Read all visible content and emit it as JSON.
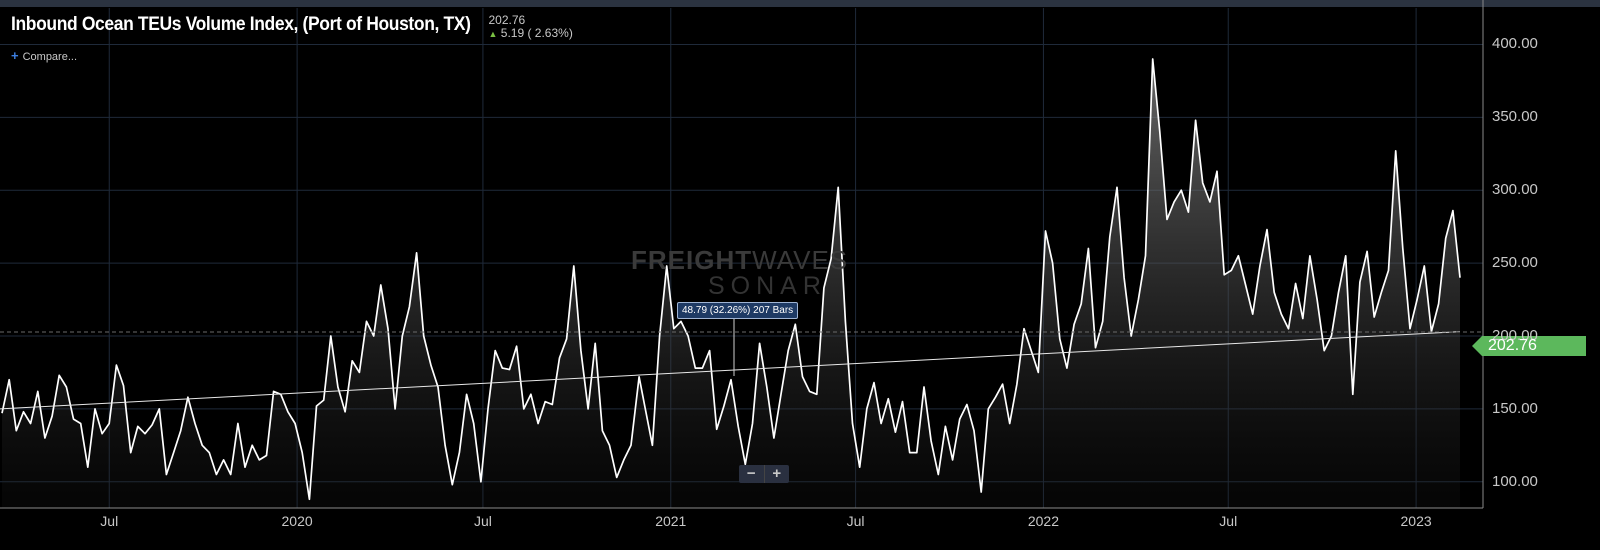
{
  "title": "Inbound Ocean TEUs Volume Index, (Port of Houston, TX)",
  "quote": {
    "last": "202.76",
    "change": "5.19",
    "change_pct": "( 2.63%)"
  },
  "compare_label": "Compare...",
  "watermark": {
    "brand_bold": "FREIGHT",
    "brand_light": "WAVES",
    "product": "SONAR"
  },
  "last_value_badge": "202.76",
  "measure_label": "48.79 (32.26%) 207 Bars",
  "zoom": {
    "minus": "−",
    "plus": "+"
  },
  "colors": {
    "background": "#000000",
    "line": "#ffffff",
    "grid": "#1f2a3a",
    "badge": "#5cb85c",
    "up_arrow": "#7ac143"
  },
  "chart_data": {
    "type": "area",
    "title": "Inbound Ocean TEUs Volume Index, (Port of Houston, TX)",
    "x_tick_labels": [
      "Jul",
      "2020",
      "Jul",
      "2021",
      "Jul",
      "2022",
      "Jul",
      "2023"
    ],
    "y_tick_labels": [
      "100.00",
      "150.00",
      "200.00",
      "250.00",
      "300.00",
      "350.00",
      "400.00"
    ],
    "ylim": [
      82,
      425
    ],
    "grid": true,
    "x_range": [
      "2019-03-16",
      "2023-02-13"
    ],
    "series": [
      {
        "points": [
          [
            "2019-03-18",
            147
          ],
          [
            "2019-03-25",
            170
          ],
          [
            "2019-04-01",
            135
          ],
          [
            "2019-04-08",
            148
          ],
          [
            "2019-04-15",
            140
          ],
          [
            "2019-04-22",
            162
          ],
          [
            "2019-04-29",
            130
          ],
          [
            "2019-05-06",
            145
          ],
          [
            "2019-05-13",
            173
          ],
          [
            "2019-05-20",
            165
          ],
          [
            "2019-05-27",
            143
          ],
          [
            "2019-06-03",
            140
          ],
          [
            "2019-06-10",
            110
          ],
          [
            "2019-06-17",
            150
          ],
          [
            "2019-06-24",
            133
          ],
          [
            "2019-07-01",
            140
          ],
          [
            "2019-07-08",
            180
          ],
          [
            "2019-07-15",
            166
          ],
          [
            "2019-07-22",
            120
          ],
          [
            "2019-07-29",
            138
          ],
          [
            "2019-08-05",
            133
          ],
          [
            "2019-08-12",
            139
          ],
          [
            "2019-08-19",
            150
          ],
          [
            "2019-08-26",
            105
          ],
          [
            "2019-09-02",
            120
          ],
          [
            "2019-09-09",
            135
          ],
          [
            "2019-09-16",
            158
          ],
          [
            "2019-09-23",
            140
          ],
          [
            "2019-09-30",
            125
          ],
          [
            "2019-10-07",
            120
          ],
          [
            "2019-10-14",
            105
          ],
          [
            "2019-10-21",
            115
          ],
          [
            "2019-10-28",
            105
          ],
          [
            "2019-11-04",
            140
          ],
          [
            "2019-11-11",
            110
          ],
          [
            "2019-11-18",
            125
          ],
          [
            "2019-11-25",
            115
          ],
          [
            "2019-12-02",
            118
          ],
          [
            "2019-12-09",
            162
          ],
          [
            "2019-12-16",
            160
          ],
          [
            "2019-12-23",
            148
          ],
          [
            "2019-12-30",
            140
          ],
          [
            "2020-01-06",
            120
          ],
          [
            "2020-01-13",
            88
          ],
          [
            "2020-01-20",
            152
          ],
          [
            "2020-01-27",
            156
          ],
          [
            "2020-02-03",
            200
          ],
          [
            "2020-02-10",
            165
          ],
          [
            "2020-02-17",
            148
          ],
          [
            "2020-02-24",
            183
          ],
          [
            "2020-03-02",
            175
          ],
          [
            "2020-03-09",
            210
          ],
          [
            "2020-03-16",
            200
          ],
          [
            "2020-03-23",
            235
          ],
          [
            "2020-03-30",
            205
          ],
          [
            "2020-04-06",
            150
          ],
          [
            "2020-04-13",
            200
          ],
          [
            "2020-04-20",
            220
          ],
          [
            "2020-04-27",
            257
          ],
          [
            "2020-05-04",
            200
          ],
          [
            "2020-05-11",
            180
          ],
          [
            "2020-05-18",
            165
          ],
          [
            "2020-05-25",
            125
          ],
          [
            "2020-06-01",
            98
          ],
          [
            "2020-06-08",
            120
          ],
          [
            "2020-06-15",
            160
          ],
          [
            "2020-06-22",
            140
          ],
          [
            "2020-06-29",
            100
          ],
          [
            "2020-07-06",
            150
          ],
          [
            "2020-07-13",
            190
          ],
          [
            "2020-07-20",
            178
          ],
          [
            "2020-07-27",
            177
          ],
          [
            "2020-08-03",
            193
          ],
          [
            "2020-08-10",
            150
          ],
          [
            "2020-08-17",
            160
          ],
          [
            "2020-08-24",
            140
          ],
          [
            "2020-08-31",
            155
          ],
          [
            "2020-09-07",
            153
          ],
          [
            "2020-09-14",
            185
          ],
          [
            "2020-09-21",
            198
          ],
          [
            "2020-09-28",
            248
          ],
          [
            "2020-10-05",
            190
          ],
          [
            "2020-10-12",
            150
          ],
          [
            "2020-10-19",
            195
          ],
          [
            "2020-10-26",
            135
          ],
          [
            "2020-11-02",
            125
          ],
          [
            "2020-11-09",
            103
          ],
          [
            "2020-11-16",
            115
          ],
          [
            "2020-11-23",
            125
          ],
          [
            "2020-12-01",
            172
          ],
          [
            "2020-12-07",
            150
          ],
          [
            "2020-12-14",
            125
          ],
          [
            "2020-12-21",
            200
          ],
          [
            "2020-12-28",
            248
          ],
          [
            "2021-01-04",
            205
          ],
          [
            "2021-01-11",
            210
          ],
          [
            "2021-01-18",
            200
          ],
          [
            "2021-01-25",
            178
          ],
          [
            "2021-02-01",
            178
          ],
          [
            "2021-02-08",
            190
          ],
          [
            "2021-02-15",
            136
          ],
          [
            "2021-02-22",
            152
          ],
          [
            "2021-03-01",
            170
          ],
          [
            "2021-03-08",
            138
          ],
          [
            "2021-03-15",
            112
          ],
          [
            "2021-03-22",
            140
          ],
          [
            "2021-03-29",
            195
          ],
          [
            "2021-04-05",
            165
          ],
          [
            "2021-04-12",
            130
          ],
          [
            "2021-04-19",
            160
          ],
          [
            "2021-04-26",
            190
          ],
          [
            "2021-05-03",
            208
          ],
          [
            "2021-05-10",
            172
          ],
          [
            "2021-05-17",
            162
          ],
          [
            "2021-05-24",
            160
          ],
          [
            "2021-05-31",
            233
          ],
          [
            "2021-06-07",
            253
          ],
          [
            "2021-06-14",
            302
          ],
          [
            "2021-06-21",
            210
          ],
          [
            "2021-06-28",
            140
          ],
          [
            "2021-07-05",
            110
          ],
          [
            "2021-07-12",
            150
          ],
          [
            "2021-07-19",
            168
          ],
          [
            "2021-07-26",
            140
          ],
          [
            "2021-08-02",
            157
          ],
          [
            "2021-08-09",
            134
          ],
          [
            "2021-08-16",
            155
          ],
          [
            "2021-08-23",
            120
          ],
          [
            "2021-08-30",
            120
          ],
          [
            "2021-09-06",
            165
          ],
          [
            "2021-09-13",
            128
          ],
          [
            "2021-09-20",
            105
          ],
          [
            "2021-09-27",
            138
          ],
          [
            "2021-10-04",
            115
          ],
          [
            "2021-10-11",
            143
          ],
          [
            "2021-10-18",
            153
          ],
          [
            "2021-10-25",
            135
          ],
          [
            "2021-11-01",
            93
          ],
          [
            "2021-11-08",
            150
          ],
          [
            "2021-11-15",
            158
          ],
          [
            "2021-11-22",
            167
          ],
          [
            "2021-11-29",
            140
          ],
          [
            "2021-12-06",
            167
          ],
          [
            "2021-12-13",
            205
          ],
          [
            "2021-12-20",
            190
          ],
          [
            "2021-12-27",
            175
          ],
          [
            "2022-01-03",
            272
          ],
          [
            "2022-01-10",
            250
          ],
          [
            "2022-01-17",
            198
          ],
          [
            "2022-01-24",
            178
          ],
          [
            "2022-01-31",
            208
          ],
          [
            "2022-02-07",
            222
          ],
          [
            "2022-02-14",
            260
          ],
          [
            "2022-02-21",
            192
          ],
          [
            "2022-02-28",
            210
          ],
          [
            "2022-03-07",
            268
          ],
          [
            "2022-03-14",
            302
          ],
          [
            "2022-03-21",
            240
          ],
          [
            "2022-03-28",
            200
          ],
          [
            "2022-04-04",
            225
          ],
          [
            "2022-04-11",
            255
          ],
          [
            "2022-04-18",
            390
          ],
          [
            "2022-04-25",
            340
          ],
          [
            "2022-05-02",
            280
          ],
          [
            "2022-05-09",
            292
          ],
          [
            "2022-05-16",
            300
          ],
          [
            "2022-05-23",
            285
          ],
          [
            "2022-05-30",
            348
          ],
          [
            "2022-06-06",
            305
          ],
          [
            "2022-06-13",
            292
          ],
          [
            "2022-06-20",
            313
          ],
          [
            "2022-06-27",
            242
          ],
          [
            "2022-07-04",
            245
          ],
          [
            "2022-07-11",
            255
          ],
          [
            "2022-07-18",
            235
          ],
          [
            "2022-07-25",
            215
          ],
          [
            "2022-08-01",
            248
          ],
          [
            "2022-08-08",
            273
          ],
          [
            "2022-08-15",
            230
          ],
          [
            "2022-08-22",
            215
          ],
          [
            "2022-08-29",
            205
          ],
          [
            "2022-09-05",
            236
          ],
          [
            "2022-09-12",
            212
          ],
          [
            "2022-09-19",
            255
          ],
          [
            "2022-09-26",
            225
          ],
          [
            "2022-10-03",
            190
          ],
          [
            "2022-10-10",
            200
          ],
          [
            "2022-10-17",
            230
          ],
          [
            "2022-10-24",
            255
          ],
          [
            "2022-10-31",
            160
          ],
          [
            "2022-11-07",
            237
          ],
          [
            "2022-11-14",
            258
          ],
          [
            "2022-11-21",
            213
          ],
          [
            "2022-11-28",
            230
          ],
          [
            "2022-12-05",
            245
          ],
          [
            "2022-12-12",
            327
          ],
          [
            "2022-12-19",
            260
          ],
          [
            "2022-12-26",
            205
          ],
          [
            "2023-01-02",
            225
          ],
          [
            "2023-01-09",
            248
          ],
          [
            "2023-01-16",
            203
          ],
          [
            "2023-01-23",
            222
          ],
          [
            "2023-01-30",
            267
          ],
          [
            "2023-02-06",
            286
          ],
          [
            "2023-02-13",
            240
          ]
        ]
      }
    ],
    "trend_line": [
      [
        "2019-03-16",
        150
      ],
      [
        "2023-02-13",
        203
      ]
    ],
    "last_value": 202.76
  }
}
